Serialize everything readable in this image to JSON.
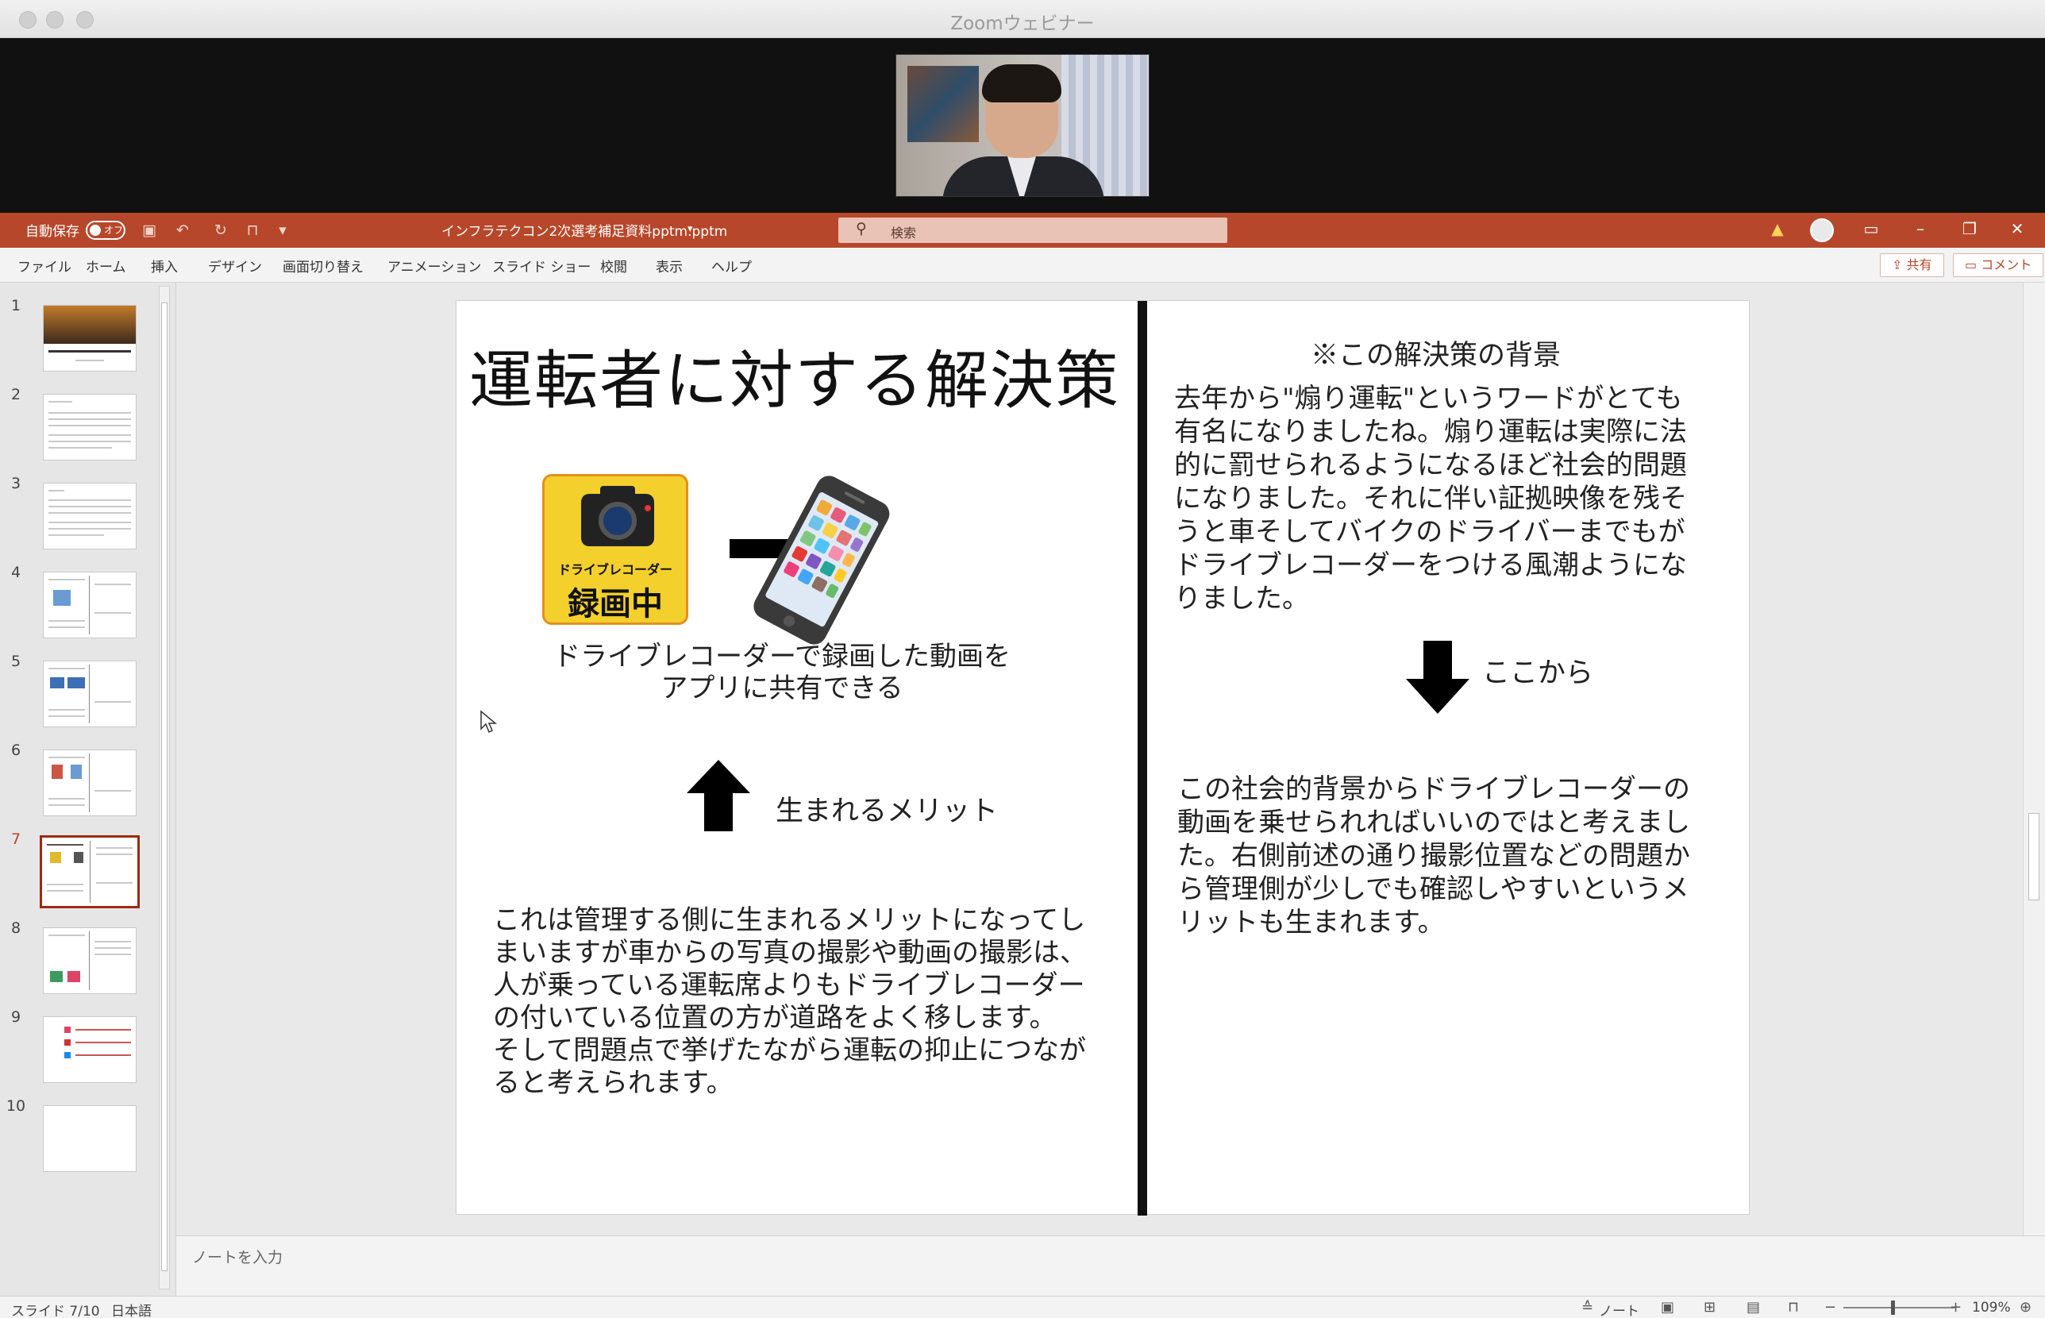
{
  "zoom": {
    "window_title": "Zoomウェビナー"
  },
  "ppt": {
    "autosave_label": "自動保存",
    "autosave_state": "オフ",
    "file_name": "インフラテクコン2次選考補足資料pptm.pptm",
    "search_placeholder": "検索",
    "tabs": [
      "ファイル",
      "ホーム",
      "挿入",
      "デザイン",
      "画面切り替え",
      "アニメーション",
      "スライド ショー",
      "校閲",
      "表示",
      "ヘルプ"
    ],
    "share_label": "共有",
    "comment_label": "コメント",
    "thumbnails": [
      "1",
      "2",
      "3",
      "4",
      "5",
      "6",
      "7",
      "8",
      "9",
      "10"
    ],
    "active_slide": 7,
    "notes_placeholder": "ノートを入力",
    "status": {
      "slide_counter": "スライド 7/10",
      "language": "日本語",
      "notes_button": "ノート",
      "zoom_level": "109%"
    }
  },
  "slide": {
    "title": "運転者に対する解決策",
    "recorder_text_top": "ドライブレコーダー",
    "recorder_text_bottom": "録画中",
    "caption_line1": "ドライブレコーダーで録画した動画を",
    "caption_line2": "アプリに共有できる",
    "merit_label": "生まれるメリット",
    "left_body": [
      "これは管理する側に生まれるメリットになってし",
      "まいますが車からの写真の撮影や動画の撮影は、",
      "人が乗っている運転席よりもドライブレコーダー",
      "の付いている位置の方が道路をよく移します。",
      "そして問題点で挙げたながら運転の抑止につなが",
      "ると考えられます。"
    ],
    "right_heading": "※この解決策の背景",
    "right_body": [
      "去年から\"煽り運転\"というワードがとても",
      "有名になりましたね。煽り運転は実際に法",
      "的に罰せられるようになるほど社会的問題",
      "になりました。それに伴い証拠映像を残そ",
      "うと車そしてバイクのドライバーまでもが",
      "ドライブレコーダーをつける風潮ようにな",
      "りました。"
    ],
    "arrow_label": "ここから",
    "right_body2": [
      "この社会的背景からドライブレコーダーの",
      "動画を乗せられればいいのではと考えまし",
      "た。右側前述の通り撮影位置などの問題か",
      "ら管理側が少しでも確認しやすいというメ",
      "リットも生まれます。"
    ]
  },
  "colors": {
    "ppt_accent": "#b7472a",
    "active_thumb_border": "#9b2a12"
  }
}
